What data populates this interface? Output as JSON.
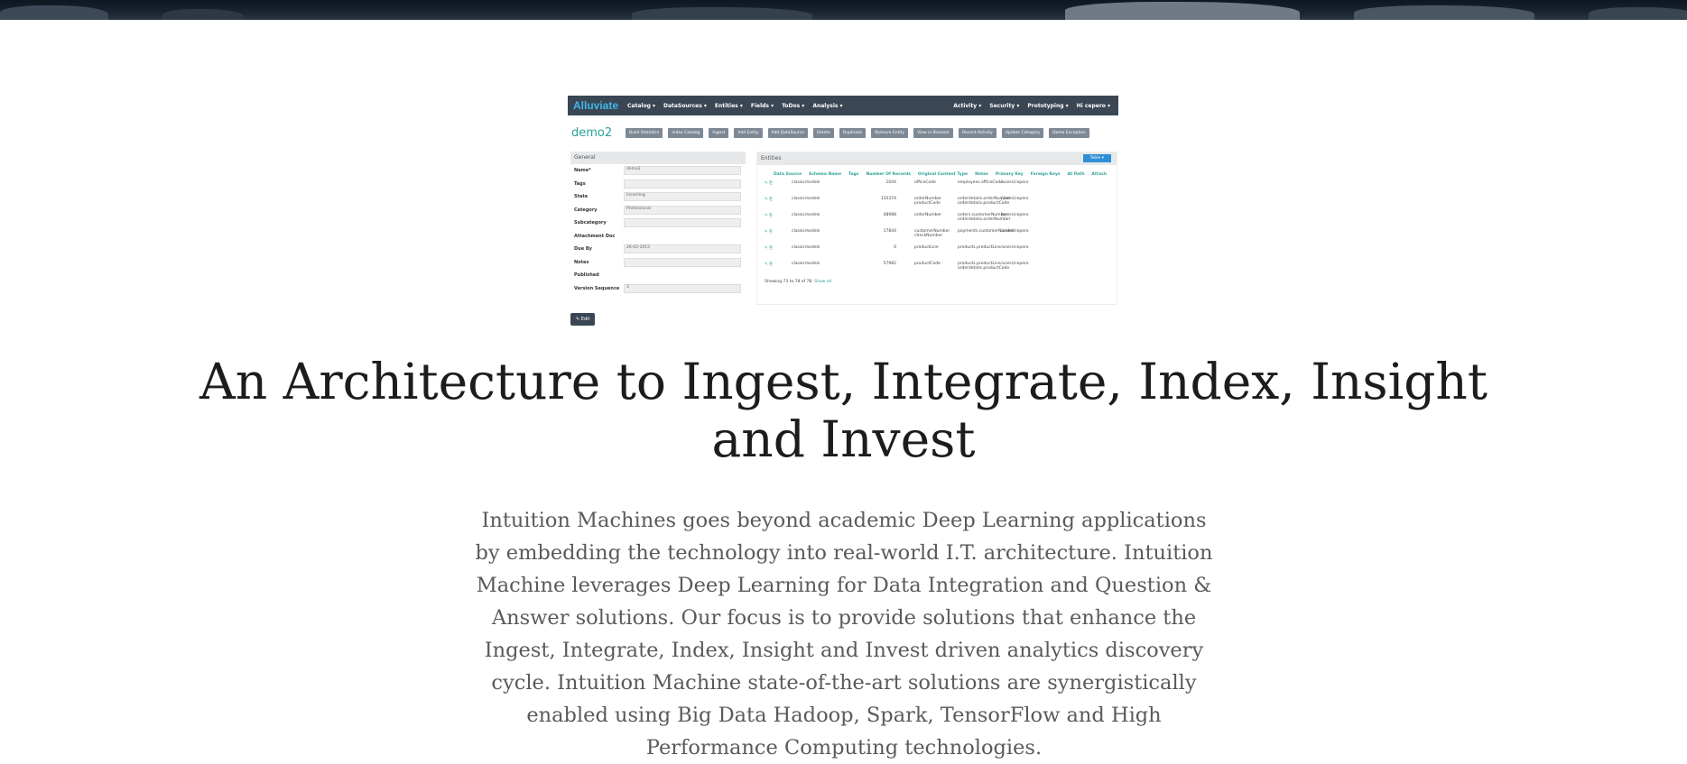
{
  "screenshot": {
    "brand": "Alluviate",
    "nav_items": [
      "Catalog ▾",
      "DataSources ▾",
      "Entities ▾",
      "Fields ▾",
      "ToDos ▾",
      "Analysis ▾"
    ],
    "nav_right": [
      "Activity ▾",
      "Security ▾",
      "Prototyping ▾",
      "Hi cepero ▾"
    ],
    "title": "demo2",
    "toolbar_buttons": [
      "Build Statistics",
      "Index Catalog",
      "Ingest",
      "Add Entity",
      "Add DataSource",
      "Delete",
      "Duplicate",
      "Remove Entity",
      "View in Browser",
      "Recent Activity",
      "Update Category",
      "Demo Exception"
    ],
    "general": {
      "heading": "General",
      "fields": [
        {
          "label": "Name*",
          "value": "demo2"
        },
        {
          "label": "Tags",
          "value": ""
        },
        {
          "label": "State",
          "value": "Incoming"
        },
        {
          "label": "Category",
          "value": "Professional"
        },
        {
          "label": "Subcategory",
          "value": ""
        },
        {
          "label": "Attachment Doc",
          "value": ""
        },
        {
          "label": "Due By",
          "value": "26-02-2015"
        },
        {
          "label": "Notes",
          "value": ""
        },
        {
          "label": "Published",
          "value": ""
        },
        {
          "label": "Version Sequence",
          "value": "3"
        }
      ]
    },
    "entities": {
      "heading": "Entities",
      "table_button": "Table ▾",
      "columns": [
        "Data Source",
        "Schema Name",
        "Tags",
        "Number Of Records",
        "Original Content Type",
        "Notes",
        "Primary Key",
        "Foreign Keys",
        "At Path",
        "Attach"
      ],
      "rows": [
        {
          "schema": "classicmodels",
          "records": "1044",
          "pk": "officeCode",
          "fk": "employees.officeCode",
          "path": "/users/cepero"
        },
        {
          "schema": "classicmodels",
          "records": "135374",
          "pk": "orderNumber productCode",
          "fk": "orderdetails.orderNumber orderdetails.productCode",
          "path": "/users/cepero"
        },
        {
          "schema": "classicmodels",
          "records": "48988",
          "pk": "orderNumber",
          "fk": "orders.customerNumber orderdetails.orderNumber",
          "path": "/users/cepero"
        },
        {
          "schema": "classicmodels",
          "records": "17844",
          "pk": "customerNumber checkNumber",
          "fk": "payments.customerNumber",
          "path": "/users/cepero"
        },
        {
          "schema": "classicmodels",
          "records": "0",
          "pk": "productLine",
          "fk": "products.productLine",
          "path": "/users/cepero"
        },
        {
          "schema": "classicmodels",
          "records": "57982",
          "pk": "productCode",
          "fk": "products.productLine orderdetails.productCode",
          "path": "/users/cepero"
        }
      ],
      "footer": "Showing 73 to 78 of 78",
      "footer_link": "Show all"
    },
    "edit_button": "✎ Edit"
  },
  "heading": "An Architecture to Ingest, Integrate, Index, Insight and Invest",
  "paragraph": "Intuition Machines goes beyond academic Deep Learning applications by embedding the technology into real-world I.T. architecture.  Intuition Machine leverages Deep Learning for Data Integration and Question & Answer solutions.  Our focus is to provide solutions that enhance the Ingest, Integrate, Index, Insight and Invest driven analytics discovery cycle.  Intuition Machine state-of-the-art solutions are synergistically enabled using Big Data Hadoop, Spark, TensorFlow and High Performance Computing technologies."
}
